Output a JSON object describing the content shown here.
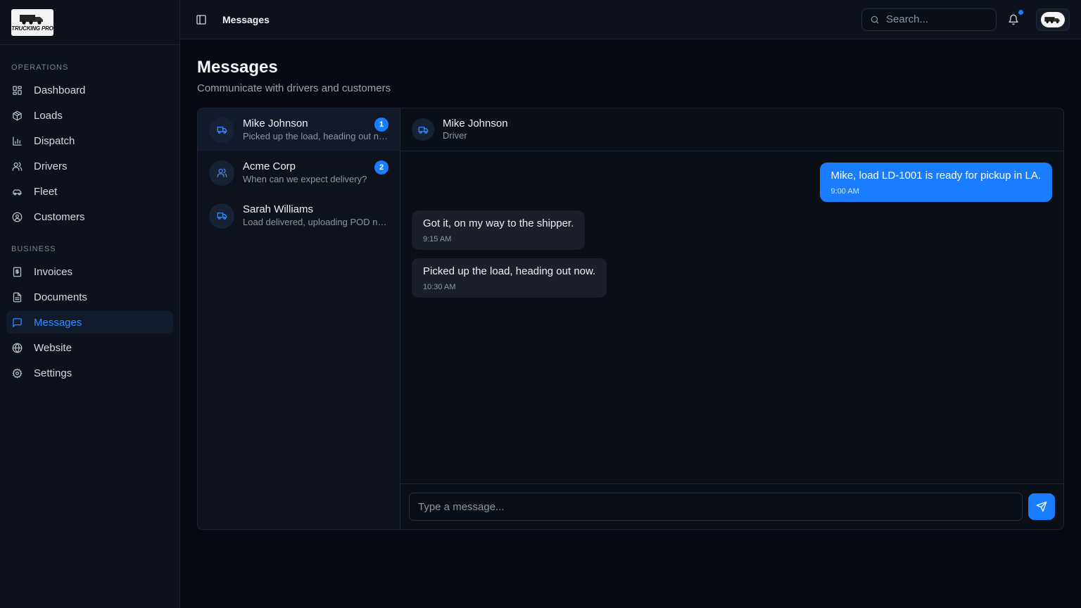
{
  "sidebar": {
    "logo_text": "TRUCKING PRO",
    "sections": [
      {
        "label": "OPERATIONS",
        "items": [
          {
            "label": "Dashboard",
            "icon": "dashboard-icon"
          },
          {
            "label": "Loads",
            "icon": "package-icon"
          },
          {
            "label": "Dispatch",
            "icon": "bar-chart-icon"
          },
          {
            "label": "Drivers",
            "icon": "users-icon"
          },
          {
            "label": "Fleet",
            "icon": "car-icon"
          },
          {
            "label": "Customers",
            "icon": "user-circle-icon"
          }
        ]
      },
      {
        "label": "BUSINESS",
        "items": [
          {
            "label": "Invoices",
            "icon": "dollar-receipt-icon"
          },
          {
            "label": "Documents",
            "icon": "document-icon"
          },
          {
            "label": "Messages",
            "icon": "message-icon",
            "active": true
          },
          {
            "label": "Website",
            "icon": "globe-icon"
          },
          {
            "label": "Settings",
            "icon": "gear-icon"
          }
        ]
      }
    ]
  },
  "topbar": {
    "breadcrumb": "Messages",
    "search_placeholder": "Search...",
    "notification_dot": true
  },
  "page": {
    "title": "Messages",
    "subtitle": "Communicate with drivers and customers"
  },
  "conversations": [
    {
      "name": "Mike Johnson",
      "preview": "Picked up the load, heading out now.",
      "unread": "1",
      "icon": "truck-icon",
      "active": true
    },
    {
      "name": "Acme Corp",
      "preview": "When can we expect delivery?",
      "unread": "2",
      "icon": "users-icon"
    },
    {
      "name": "Sarah Williams",
      "preview": "Load delivered, uploading POD now.",
      "unread": "",
      "icon": "truck-icon"
    }
  ],
  "chat": {
    "name": "Mike Johnson",
    "role": "Driver",
    "messages": [
      {
        "text": "Mike, load LD-1001 is ready for pickup in LA.",
        "time": "9:00 AM",
        "direction": "out"
      },
      {
        "text": "Got it, on my way to the shipper.",
        "time": "9:15 AM",
        "direction": "in"
      },
      {
        "text": "Picked up the load, heading out now.",
        "time": "10:30 AM",
        "direction": "in"
      }
    ],
    "composer_placeholder": "Type a message..."
  },
  "colors": {
    "accent": "#1a7cff",
    "background": "#070a12",
    "sidebar": "#0c111b"
  }
}
